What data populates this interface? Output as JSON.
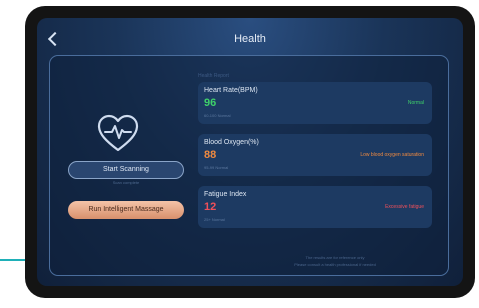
{
  "header": {
    "title": "Health"
  },
  "left": {
    "scan_label": "Start Scanning",
    "scan_hint": "Scan complete",
    "massage_label": "Run Intelligent Massage"
  },
  "report_label": "Health Report",
  "metrics": [
    {
      "name": "Heart Rate(BPM)",
      "value": "96",
      "range": "60-100 Normal",
      "status": "Normal",
      "color": "#3fd06a"
    },
    {
      "name": "Blood Oxygen(%)",
      "value": "88",
      "range": "95-99 Normal",
      "status": "Low blood oxygen saturation",
      "color": "#f08a40"
    },
    {
      "name": "Fatigue Index",
      "value": "12",
      "range": "25+ Normal",
      "status": "Excessive fatigue",
      "color": "#f0505a"
    }
  ],
  "footnote": [
    "The results are for reference only",
    "Please consult a health professional if needed"
  ],
  "icons": {
    "back": "chevron-left-icon",
    "heart": "heart-pulse-icon"
  }
}
